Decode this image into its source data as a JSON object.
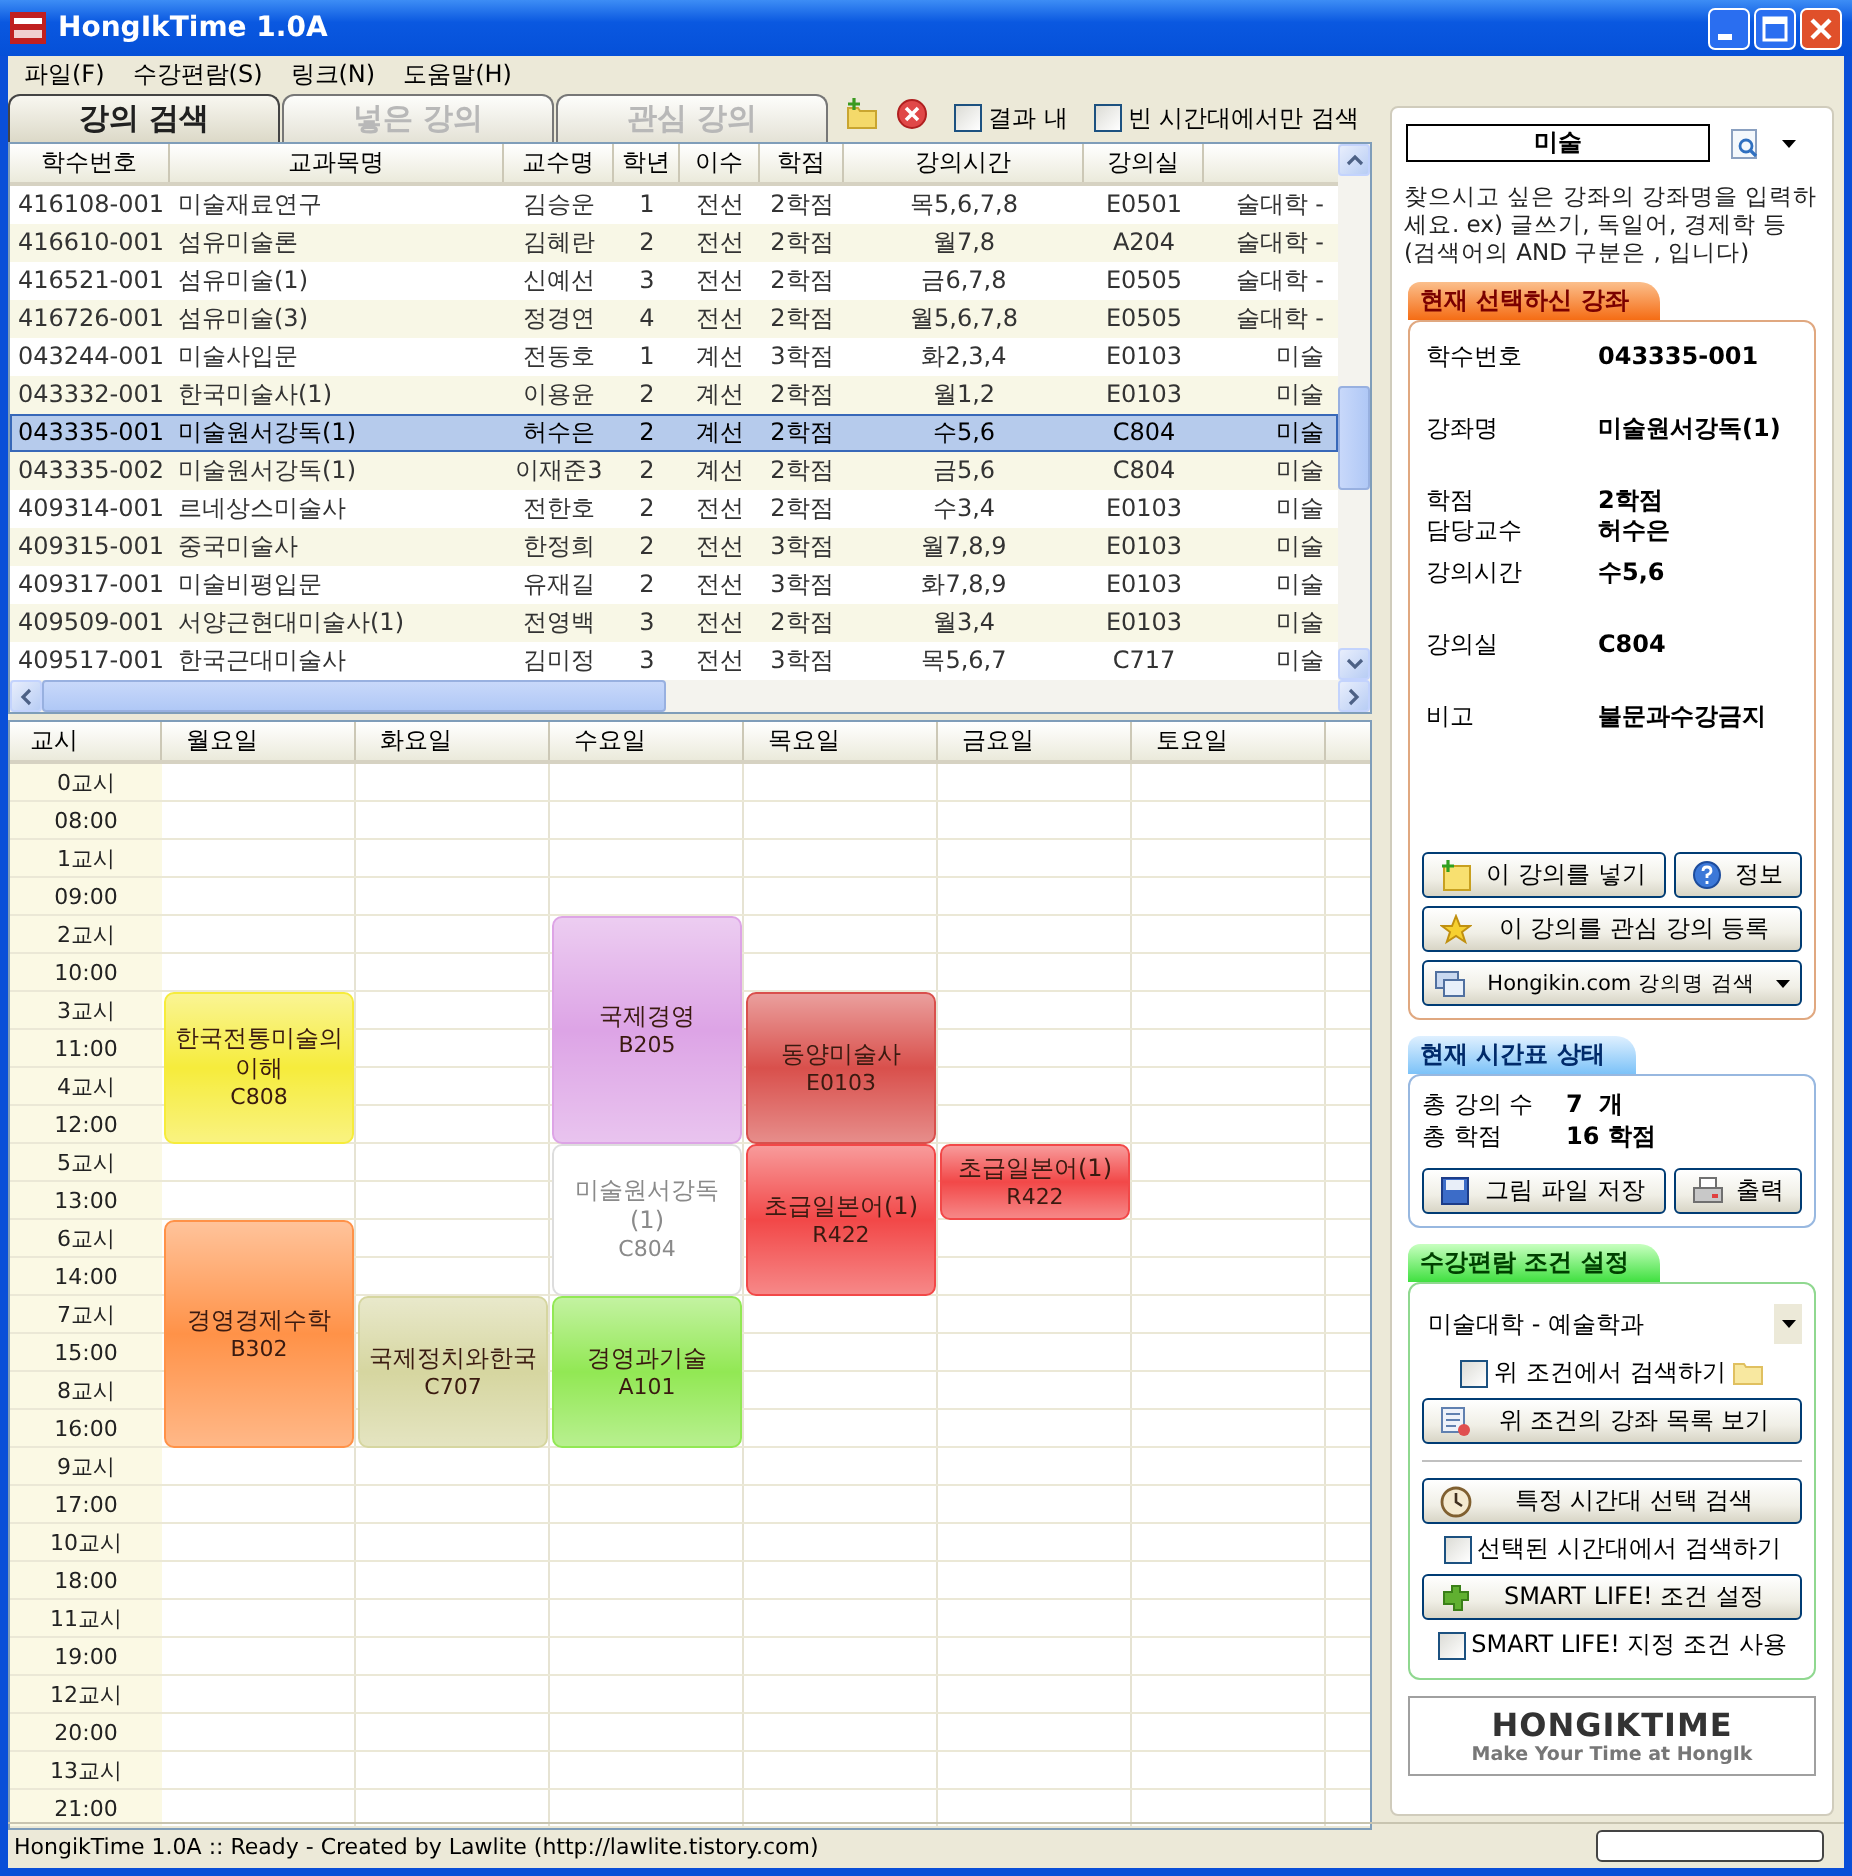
{
  "window": {
    "title": "HongIkTime 1.0A"
  },
  "menu": [
    {
      "label": "파일(F)"
    },
    {
      "label": "수강편람(S)"
    },
    {
      "label": "링크(N)"
    },
    {
      "label": "도움말(H)"
    }
  ],
  "tabs": [
    {
      "label": "강의 검색",
      "selected": true
    },
    {
      "label": "넣은 강의",
      "selected": false
    },
    {
      "label": "관심 강의",
      "selected": false
    }
  ],
  "filters": [
    {
      "label": "결과 내",
      "checked": false
    },
    {
      "label": "빈 시간대에서만 검색",
      "checked": false
    }
  ],
  "table": {
    "columns": [
      "학수번호",
      "교과목명",
      "교수명",
      "학년",
      "이수",
      "학점",
      "강의시간",
      "강의실"
    ],
    "rows": [
      {
        "cells": [
          "416108-001",
          "미술재료연구",
          "김승운",
          "1",
          "전선",
          "2학점",
          "목5,6,7,8",
          "E0501",
          "술대학 -"
        ],
        "selected": false
      },
      {
        "cells": [
          "416610-001",
          "섬유미술론",
          "김혜란",
          "2",
          "전선",
          "2학점",
          "월7,8",
          "A204",
          "술대학 -"
        ],
        "selected": false
      },
      {
        "cells": [
          "416521-001",
          "섬유미술(1)",
          "신예선",
          "3",
          "전선",
          "2학점",
          "금6,7,8",
          "E0505",
          "술대학 -"
        ],
        "selected": false
      },
      {
        "cells": [
          "416726-001",
          "섬유미술(3)",
          "정경연",
          "4",
          "전선",
          "2학점",
          "월5,6,7,8",
          "E0505",
          "술대학 -"
        ],
        "selected": false
      },
      {
        "cells": [
          "043244-001",
          "미술사입문",
          "전동호",
          "1",
          "계선",
          "3학점",
          "화2,3,4",
          "E0103",
          "미술"
        ],
        "selected": false
      },
      {
        "cells": [
          "043332-001",
          "한국미술사(1)",
          "이용윤",
          "2",
          "계선",
          "2학점",
          "월1,2",
          "E0103",
          "미술"
        ],
        "selected": false
      },
      {
        "cells": [
          "043335-001",
          "미술원서강독(1)",
          "허수은",
          "2",
          "계선",
          "2학점",
          "수5,6",
          "C804",
          "미술"
        ],
        "selected": true
      },
      {
        "cells": [
          "043335-002",
          "미술원서강독(1)",
          "이재준3",
          "2",
          "계선",
          "2학점",
          "금5,6",
          "C804",
          "미술"
        ],
        "selected": false
      },
      {
        "cells": [
          "409314-001",
          "르네상스미술사",
          "전한호",
          "2",
          "전선",
          "2학점",
          "수3,4",
          "E0103",
          "미술"
        ],
        "selected": false
      },
      {
        "cells": [
          "409315-001",
          "중국미술사",
          "한정희",
          "2",
          "전선",
          "3학점",
          "월7,8,9",
          "E0103",
          "미술"
        ],
        "selected": false
      },
      {
        "cells": [
          "409317-001",
          "미술비평입문",
          "유재길",
          "2",
          "전선",
          "3학점",
          "화7,8,9",
          "E0103",
          "미술"
        ],
        "selected": false
      },
      {
        "cells": [
          "409509-001",
          "서양근현대미술사(1)",
          "전영백",
          "3",
          "전선",
          "2학점",
          "월3,4",
          "E0103",
          "미술"
        ],
        "selected": false
      },
      {
        "cells": [
          "409517-001",
          "한국근대미술사",
          "김미정",
          "3",
          "전선",
          "3학점",
          "목5,6,7",
          "C717",
          "미술"
        ],
        "selected": false
      }
    ]
  },
  "timetable": {
    "corner": "교시",
    "days": [
      "월요일",
      "화요일",
      "수요일",
      "목요일",
      "금요일",
      "토요일"
    ],
    "slots": [
      "0교시",
      "08:00",
      "1교시",
      "09:00",
      "2교시",
      "10:00",
      "3교시",
      "11:00",
      "4교시",
      "12:00",
      "5교시",
      "13:00",
      "6교시",
      "14:00",
      "7교시",
      "15:00",
      "8교시",
      "16:00",
      "9교시",
      "17:00",
      "10교시",
      "18:00",
      "11교시",
      "19:00",
      "12교시",
      "20:00",
      "13교시",
      "21:00"
    ],
    "blocks": [
      {
        "title": "한국전통미술의 이해",
        "room": "C808",
        "color": "#f6ec3c",
        "selected": false
      },
      {
        "title": "국제경영",
        "room": "B205",
        "color": "#dda4e6",
        "selected": false
      },
      {
        "title": "동양미술사",
        "room": "E0103",
        "color": "#d9504c",
        "selected": false
      },
      {
        "title": "미술원서강독(1)",
        "room": "C804",
        "color": "#ffffff",
        "selected": true
      },
      {
        "title": "초급일본어(1)",
        "room": "R422",
        "color": "#f24848",
        "selected": false
      },
      {
        "title": "초급일본어(1)",
        "room": "R422",
        "color": "#f24848",
        "selected": false
      },
      {
        "title": "경영경제수학",
        "room": "B302",
        "color": "#ff9248",
        "selected": false
      },
      {
        "title": "국제정치와한국",
        "room": "C707",
        "color": "#d6d6a0",
        "selected": false
      },
      {
        "title": "경영과기술",
        "room": "A101",
        "color": "#92e854",
        "selected": false
      }
    ]
  },
  "search": {
    "value": "미술"
  },
  "help_text": "찾으시고 싶은 강좌의 강좌명을 입력하세요. ex) 글쓰기, 독일어, 경제학 등 (검색어의 AND 구분은 , 입니다)",
  "selected_course": {
    "title": "현재 선택하신 강좌",
    "field_groups": [
      [
        {
          "label": "학수번호",
          "value": "043335-001"
        }
      ],
      [
        {
          "label": "강좌명",
          "value": "미술원서강독(1)"
        }
      ],
      [
        {
          "label": "학점",
          "value": "2학점"
        },
        {
          "label": "담당교수",
          "value": "허수은"
        }
      ],
      [
        {
          "label": "강의시간",
          "value": "수5,6"
        }
      ],
      [
        {
          "label": "강의실",
          "value": "C804"
        }
      ],
      [
        {
          "label": "비고",
          "value": "불문과수강금지"
        }
      ]
    ],
    "buttons": [
      {
        "label": "이 강의를 넣기",
        "kind": "add"
      },
      {
        "label": "정보",
        "kind": "info"
      },
      {
        "label": "이 강의를 관심 강의 등록",
        "kind": "star"
      },
      {
        "label": "Hongikin.com 강의명 검색",
        "kind": "web"
      }
    ]
  },
  "timetable_status": {
    "title": "현재 시간표 상태",
    "stats": [
      {
        "label": "총 강의 수",
        "value": "7  개"
      },
      {
        "label": "총 학점",
        "value": "16 학점"
      }
    ],
    "buttons": [
      {
        "label": "그림 파일 저장",
        "kind": "save"
      },
      {
        "label": "출력",
        "kind": "print"
      }
    ]
  },
  "conditions": {
    "title": "수강편람 조건 설정",
    "department": "미술대학 - 예술학과",
    "items": [
      {
        "kind": "checkbox",
        "label": "위 조건에서 검색하기",
        "checked": false
      },
      {
        "kind": "button",
        "label": "위 조건의 강좌 목록 보기"
      },
      {
        "kind": "divider"
      },
      {
        "kind": "button",
        "label": "특정 시간대 선택 검색"
      },
      {
        "kind": "checkbox",
        "label": "선택된 시간대에서 검색하기",
        "checked": false
      },
      {
        "kind": "button",
        "label": "SMART LIFE! 조건 설정"
      },
      {
        "kind": "checkbox",
        "label": "SMART LIFE! 지정 조건 사용",
        "checked": false
      }
    ]
  },
  "logo": {
    "title": "HONGIKTIME",
    "tagline": "Make Your Time at HongIk"
  },
  "status_bar": {
    "text": "HongikTime 1.0A :: Ready - Created by Lawlite (http://lawlite.tistory.com)"
  }
}
